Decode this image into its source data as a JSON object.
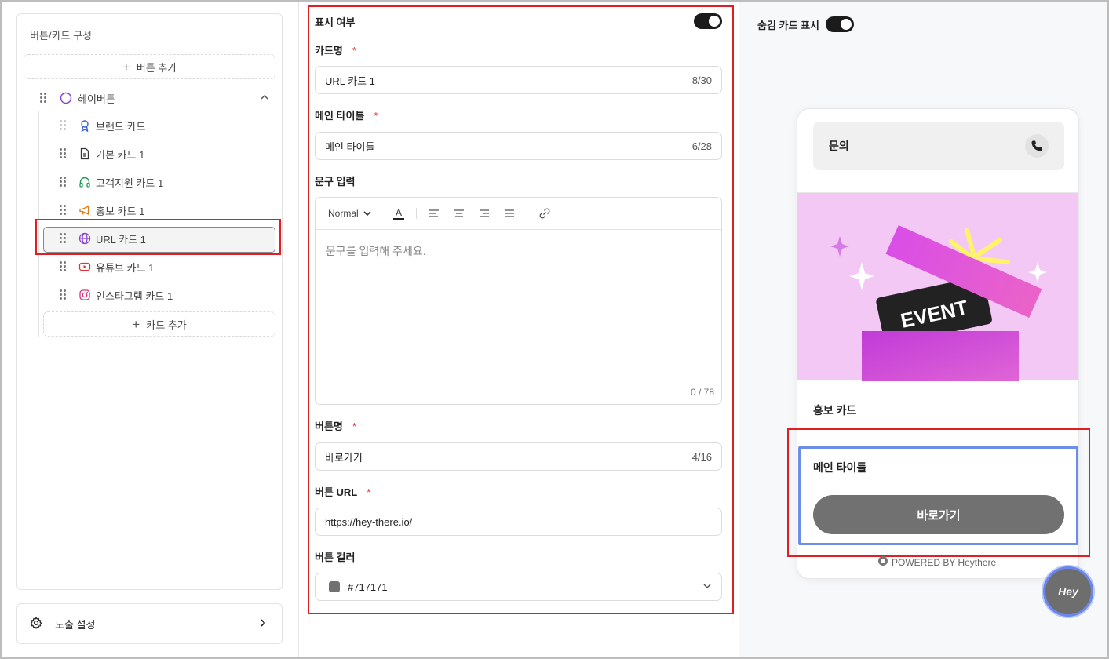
{
  "left_panel": {
    "title": "버튼/카드 구성",
    "add_button_label": "버튼 추가",
    "group": {
      "label": "헤이버튼"
    },
    "cards": [
      {
        "label": "브랜드 카드",
        "icon": "award-icon"
      },
      {
        "label": "기본 카드 1",
        "icon": "document-icon"
      },
      {
        "label": "고객지원 카드 1",
        "icon": "headphones-icon"
      },
      {
        "label": "홍보 카드 1",
        "icon": "megaphone-icon"
      },
      {
        "label": "URL 카드 1",
        "icon": "globe-icon",
        "selected": true
      },
      {
        "label": "유튜브 카드 1",
        "icon": "youtube-icon"
      },
      {
        "label": "인스타그램 카드 1",
        "icon": "instagram-icon"
      }
    ],
    "add_card_label": "카드 추가",
    "exposure_settings_label": "노출 설정"
  },
  "form": {
    "visibility_label": "표시 여부",
    "visibility_on": true,
    "card_name": {
      "label": "카드명",
      "required": "*",
      "value": "URL 카드 1",
      "count": "8/30"
    },
    "main_title": {
      "label": "메인 타이틀",
      "required": "*",
      "value": "메인 타이틀",
      "count": "6/28"
    },
    "text_input": {
      "label": "문구 입력",
      "format": "Normal",
      "placeholder": "문구를 입력해 주세요.",
      "count": "0 / 78"
    },
    "button_name": {
      "label": "버튼명",
      "required": "*",
      "value": "바로가기",
      "count": "4/16"
    },
    "button_url": {
      "label": "버튼 URL",
      "required": "*",
      "value": "https://hey-there.io/"
    },
    "button_color": {
      "label": "버튼 컬러",
      "value": "#717171"
    }
  },
  "preview": {
    "show_hidden_label": "숨김 카드 표시",
    "show_hidden_on": true,
    "inquiry_label": "문의",
    "banner_text": "EVENT",
    "promo_card_title": "홍보 카드",
    "main_title": "메인 타이틀",
    "button_label": "바로가기",
    "powered_by": "POWERED BY Heythere",
    "hey_badge": "Hey"
  },
  "colors": {
    "accent_red": "#e01e24",
    "highlight_blue": "#6d8ee8",
    "button_color": "#717171"
  }
}
